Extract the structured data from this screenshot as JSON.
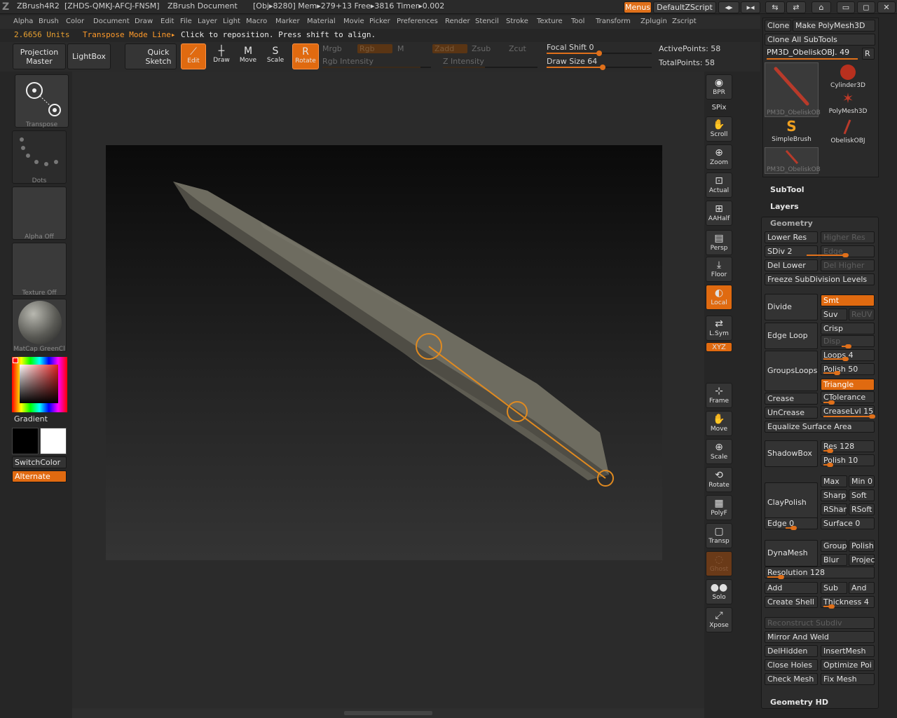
{
  "titlebar": {
    "app": "ZBrush4R2",
    "serial": "[ZHDS-QMKJ-AFCJ-FNSM]",
    "document": "ZBrush Document",
    "stats": "[Obj▸8280]  Mem▸279+13  Free▸3816  Timer▸0.002",
    "menus": "Menus",
    "script": "DefaultZScript"
  },
  "menu": [
    "Alpha",
    "Brush",
    "Color",
    "Document",
    "Draw",
    "Edit",
    "File",
    "Layer",
    "Light",
    "Macro",
    "Marker",
    "Material",
    "Movie",
    "Picker",
    "Preferences",
    "Render",
    "Stencil",
    "Stroke",
    "Texture",
    "Tool",
    "Transform",
    "Zplugin",
    "Zscript"
  ],
  "info": {
    "units": "2.6656 Units",
    "mode": "Transpose Mode Line▸",
    "hint": "Click to reposition. Press shift to align."
  },
  "toolbar": {
    "projection_master": "Projection Master",
    "lightbox": "LightBox",
    "quick_sketch": "Quick Sketch",
    "edit": "Edit",
    "draw": "Draw",
    "move": "Move",
    "scale": "Scale",
    "rotate": "Rotate",
    "mrgb": "Mrgb",
    "rgb": "Rgb",
    "m": "M",
    "zadd": "Zadd",
    "zsub": "Zsub",
    "zcut": "Zcut",
    "rgb_intensity": "Rgb Intensity",
    "z_intensity": "Z Intensity",
    "focal_shift": "Focal Shift 0",
    "draw_size": "Draw Size 64",
    "active_points": "ActivePoints: 58",
    "total_points": "TotalPoints: 58",
    "focal_shift_value": 0,
    "draw_size_value": 64
  },
  "left": {
    "transpose": "Transpose",
    "dots": "Dots",
    "alpha": "Alpha  Off",
    "texture": "Texture  Off",
    "material": "MatCap  GreenCl",
    "gradient": "Gradient",
    "switchcolor": "SwitchColor",
    "alternate": "Alternate"
  },
  "shelf": [
    "BPR",
    "SPix",
    "Scroll",
    "Zoom",
    "Actual",
    "AAHalf",
    "Persp",
    "Floor",
    "Local",
    "L.Sym",
    "XYZ",
    "Frame",
    "Move",
    "Scale",
    "Rotate",
    "PolyF",
    "Transp",
    "Ghost",
    "Solo",
    "Xpose"
  ],
  "tool": {
    "clone": "Clone",
    "make_polymesh": "Make PolyMesh3D",
    "clone_all": "Clone  All  SubTools",
    "current": "PM3D_ObeliskOBJ. 49",
    "r": "R",
    "thumbs": [
      "PM3D_ObeliskOB",
      "Cylinder3D",
      "PolyMesh3D",
      "SimpleBrush",
      "ObeliskOBJ",
      "PM3D_ObeliskOB"
    ]
  },
  "sections": {
    "subtool": "SubTool",
    "layers": "Layers",
    "geometry": "Geometry",
    "geometry_hd": "Geometry HD"
  },
  "geometry": {
    "lower_res": "Lower Res",
    "higher_res": "Higher Res",
    "sdiv": "SDiv 2",
    "edge": "Edge",
    "del_lower": "Del Lower",
    "del_higher": "Del Higher",
    "freeze": "Freeze SubDivision Levels",
    "divide": "Divide",
    "smt": "Smt",
    "suv": "Suv",
    "reuv": "ReUV",
    "edge_loop": "Edge Loop",
    "crisp": "Crisp",
    "disp": "Disp",
    "groupsloops": "GroupsLoops",
    "loops": "Loops 4",
    "polish": "Polish 50",
    "triangle": "Triangle",
    "crease": "Crease",
    "ctolerance": "CTolerance",
    "uncrease": "UnCrease",
    "creaselvl": "CreaseLvl 15",
    "equalize": "Equalize Surface Area",
    "shadowbox": "ShadowBox",
    "res": "Res 128",
    "polish2": "Polish 10",
    "claypolish": "ClayPolish",
    "max": "Max",
    "min": "Min 0",
    "sharp": "Sharp",
    "soft": "Soft",
    "rshar": "RShar",
    "rsoft": "RSoft",
    "edge0": "Edge 0",
    "surface0": "Surface 0",
    "dynamesh": "DynaMesh",
    "group": "Group",
    "polish3": "Polish",
    "blur": "Blur",
    "project": "Projec",
    "resolution": "Resolution 128",
    "add": "Add",
    "sub": "Sub",
    "and": "And",
    "create_shell": "Create Shell",
    "thickness": "Thickness 4",
    "reconstruct": "Reconstruct  Subdiv",
    "mirror_weld": "Mirror  And  Weld",
    "delhidden": "DelHidden",
    "insertmesh": "InsertMesh",
    "close_holes": "Close Holes",
    "optimize": "Optimize Poi",
    "check_mesh": "Check Mesh",
    "fix_mesh": "Fix Mesh"
  }
}
